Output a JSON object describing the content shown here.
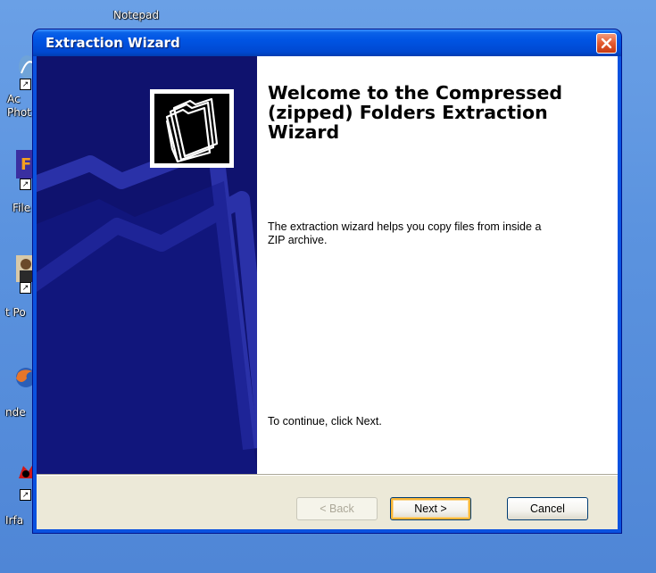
{
  "desktop": {
    "icons": [
      {
        "label": "Notepad"
      },
      {
        "label": "Ac\nPhot"
      },
      {
        "label": "File"
      },
      {
        "label": "t Po"
      },
      {
        "label": "nde"
      },
      {
        "label": "Irfa"
      }
    ]
  },
  "window": {
    "title": "Extraction Wizard",
    "heading": "Welcome to the Compressed (zipped) Folders Extraction Wizard",
    "description": "The extraction wizard helps you copy files from inside a ZIP archive.",
    "continue_text": "To continue, click Next.",
    "buttons": {
      "back": "< Back",
      "next": "Next >",
      "cancel": "Cancel"
    }
  },
  "colors": {
    "titlebar": "#0054e3",
    "side_panel": "#0f126e",
    "dialog_bg": "#ece9d8",
    "close_button": "#e35a2f"
  }
}
